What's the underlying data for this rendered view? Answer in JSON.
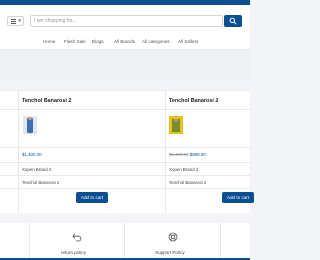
{
  "header": {
    "search_placeholder": "I am shopping for...",
    "nav": [
      "Home",
      "Flash Sale",
      "Blogs",
      "All Brands",
      "All categories",
      "All Sellers"
    ]
  },
  "compare": {
    "products": [
      {
        "title": "Tenchol Banarosi 2",
        "price_old": "",
        "price": "$1,400.00",
        "brand": "Xopen Brand 2",
        "category": "Tenchol Banarosi 2",
        "cart_label": "Add to cart",
        "thumb_color": "#3d6fb0"
      },
      {
        "title": "Tenchol Banarosi 2",
        "price_old": "$1,400.00",
        "price": "$899.00",
        "brand": "Xopen Brand 2",
        "category": "Tenchol Banarosi 2",
        "cart_label": "Add to cart",
        "thumb_color": "#e8c21a"
      }
    ]
  },
  "policies": [
    {
      "label": "return policy",
      "icon": "return-arrow-icon"
    },
    {
      "label": "Support Policy",
      "icon": "support-icon"
    }
  ],
  "colors": {
    "primary": "#0b4f92",
    "background": "#f2f4f8"
  }
}
